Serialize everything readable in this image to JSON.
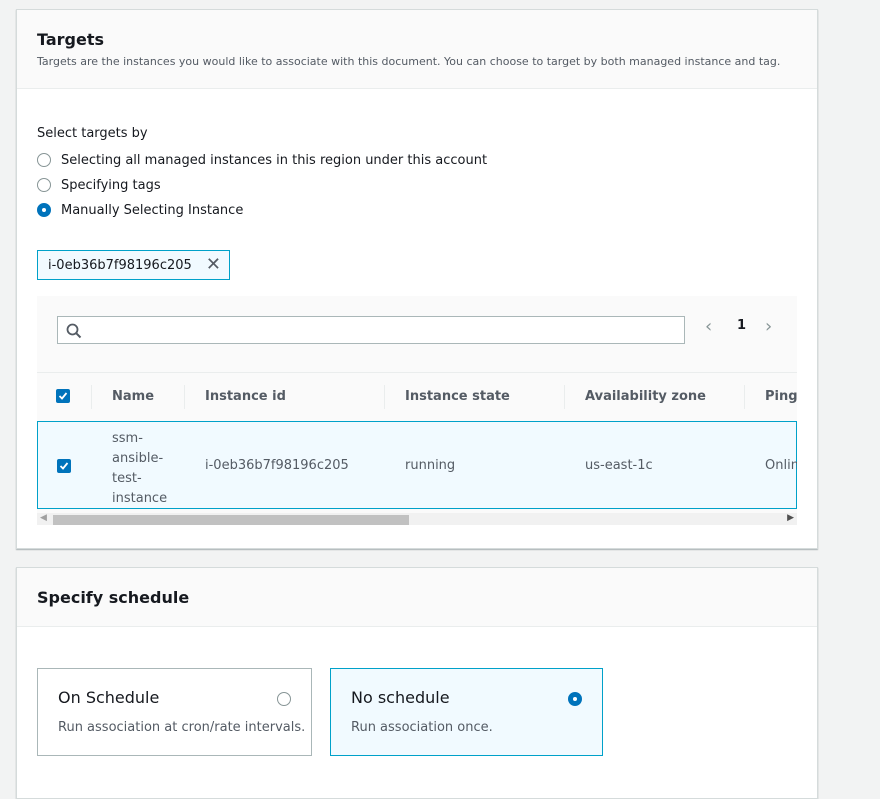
{
  "targets": {
    "title": "Targets",
    "description": "Targets are the instances you would like to associate with this document. You can choose to target by both managed instance and tag.",
    "select_label": "Select targets by",
    "options": [
      {
        "label": "Selecting all managed instances in this region under this account",
        "checked": false
      },
      {
        "label": "Specifying tags",
        "checked": false
      },
      {
        "label": "Manually Selecting Instance",
        "checked": true
      }
    ],
    "selected_token": "i-0eb36b7f98196c205",
    "search": {
      "placeholder": "",
      "value": ""
    },
    "pagination": {
      "current_page": "1"
    },
    "table": {
      "columns": [
        "Name",
        "Instance id",
        "Instance state",
        "Availability zone",
        "Ping"
      ],
      "rows": [
        {
          "name": "ssm-ansible-test-instance",
          "instance_id": "i-0eb36b7f98196c205",
          "state": "running",
          "zone": "us-east-1c",
          "ping": "Online",
          "selected": true
        }
      ]
    }
  },
  "schedule": {
    "title": "Specify schedule",
    "options": [
      {
        "title": "On Schedule",
        "description": "Run association at cron/rate intervals.",
        "selected": false
      },
      {
        "title": "No schedule",
        "description": "Run association once.",
        "selected": true
      }
    ]
  },
  "colors": {
    "accent": "#0073bb",
    "selection_border": "#00a1c9",
    "selection_bg": "#f1faff"
  }
}
